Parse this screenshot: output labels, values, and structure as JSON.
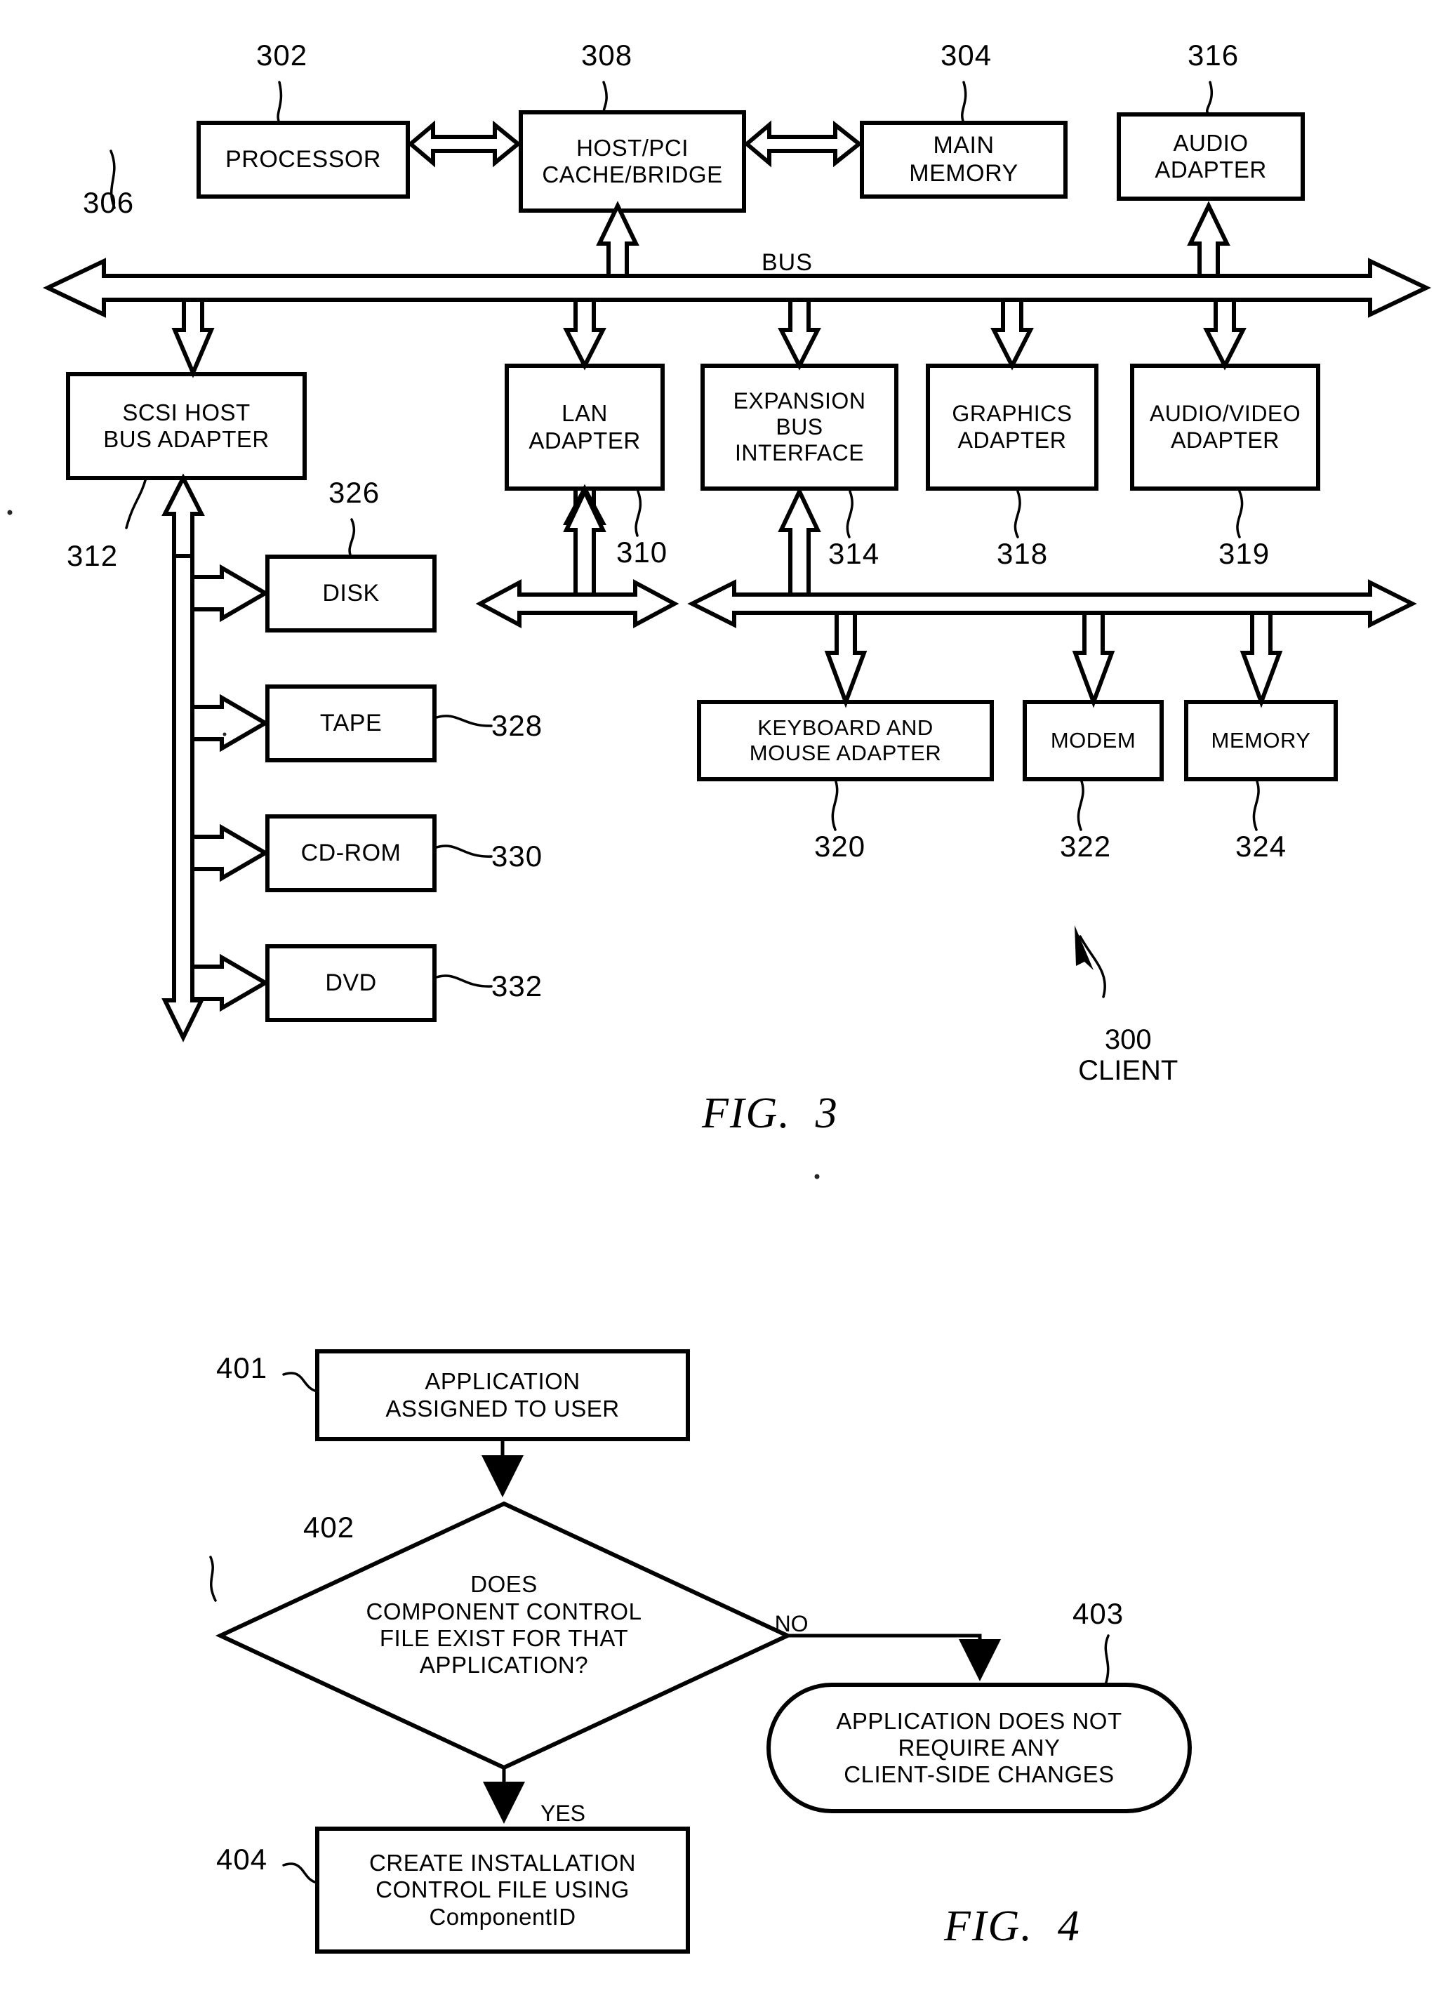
{
  "document": {
    "type": "patent-drawing-sheet",
    "figures": [
      "FIG. 3",
      "FIG. 4"
    ]
  },
  "fig3": {
    "caption": "FIG.  3",
    "bus_label": "BUS",
    "client_ref": "300",
    "client_label": "CLIENT",
    "blocks": {
      "processor": {
        "label": "PROCESSOR",
        "ref": "302"
      },
      "host_pci": {
        "line1": "HOST/PCI",
        "line2": "CACHE/BRIDGE",
        "ref": "308"
      },
      "main_memory": {
        "line1": "MAIN",
        "line2": "MEMORY",
        "ref": "304"
      },
      "audio_adapter": {
        "line1": "AUDIO",
        "line2": "ADAPTER",
        "ref": "316"
      },
      "bus": {
        "ref": "306"
      },
      "scsi_host_bus_adapter": {
        "line1": "SCSI HOST",
        "line2": "BUS ADAPTER",
        "ref": "312"
      },
      "lan_adapter": {
        "line1": "LAN",
        "line2": "ADAPTER",
        "ref": "310"
      },
      "expansion_bus_interface": {
        "line1": "EXPANSION",
        "line2": "BUS",
        "line3": "INTERFACE",
        "ref": "314"
      },
      "graphics_adapter": {
        "line1": "GRAPHICS",
        "line2": "ADAPTER",
        "ref": "318"
      },
      "audio_video_adapter": {
        "line1": "AUDIO/VIDEO",
        "line2": "ADAPTER",
        "ref": "319"
      },
      "disk": {
        "label": "DISK",
        "ref": "326"
      },
      "tape": {
        "label": "TAPE",
        "ref": "328"
      },
      "cdrom": {
        "label": "CD-ROM",
        "ref": "330"
      },
      "dvd": {
        "label": "DVD",
        "ref": "332"
      },
      "keyboard_mouse_adapter": {
        "line1": "KEYBOARD AND",
        "line2": "MOUSE ADAPTER",
        "ref": "320"
      },
      "modem": {
        "label": "MODEM",
        "ref": "322"
      },
      "memory": {
        "label": "MEMORY",
        "ref": "324"
      }
    }
  },
  "fig4": {
    "caption": "FIG.  4",
    "nodes": {
      "start": {
        "line1": "APPLICATION",
        "line2": "ASSIGNED TO USER",
        "ref": "401"
      },
      "decision": {
        "line1": "DOES",
        "line2": "COMPONENT CONTROL",
        "line3": "FILE EXIST FOR THAT",
        "line4": "APPLICATION?",
        "ref": "402"
      },
      "no_terminal": {
        "line1": "APPLICATION DOES NOT",
        "line2": "REQUIRE ANY",
        "line3": "CLIENT-SIDE CHANGES",
        "ref": "403"
      },
      "yes_process": {
        "line1": "CREATE INSTALLATION",
        "line2": "CONTROL FILE USING",
        "line3": "ComponentID",
        "ref": "404"
      }
    },
    "edges": {
      "no": "NO",
      "yes": "YES"
    }
  }
}
